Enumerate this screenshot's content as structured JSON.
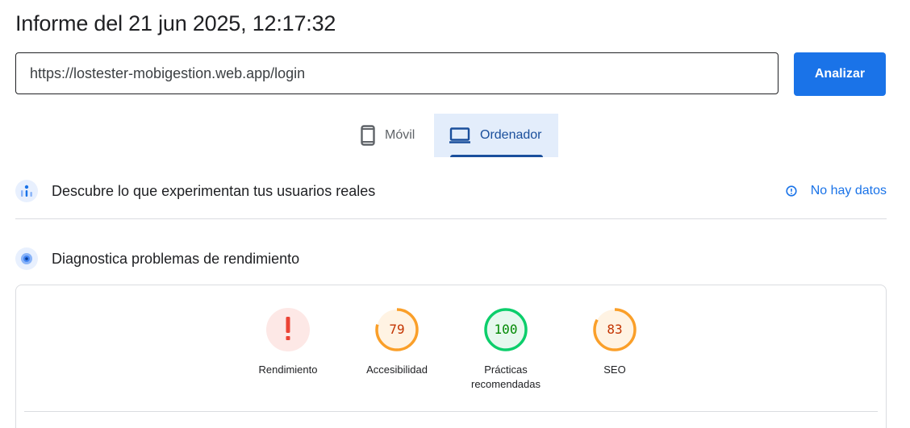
{
  "header": {
    "title": "Informe del 21 jun 2025, 12:17:32"
  },
  "search": {
    "url_value": "https://lostester-mobigestion.web.app/login",
    "analyze_label": "Analizar"
  },
  "device_tabs": [
    {
      "label": "Móvil",
      "icon": "smartphone-icon",
      "selected": false
    },
    {
      "label": "Ordenador",
      "icon": "laptop-icon",
      "selected": true
    }
  ],
  "field_data": {
    "title": "Descubre lo que experimentan tus usuarios reales",
    "icon": "users-chart-icon",
    "status_label": "No hay datos",
    "status_icon": "info-icon"
  },
  "lab_data": {
    "title": "Diagnostica problemas de rendimiento",
    "icon": "diagnostic-target-icon"
  },
  "scores": [
    {
      "label": "Rendimiento",
      "value": "!",
      "status": "error",
      "color": "#eb4335",
      "bg": "#fde8e6"
    },
    {
      "label": "Accesibilidad",
      "value": "79",
      "score": 79,
      "status": "average",
      "color": "#fa9f29",
      "text_color": "#c33300",
      "bg": "#fff3e3"
    },
    {
      "label": "Prácticas recomendadas",
      "value": "100",
      "score": 100,
      "status": "pass",
      "color": "#0cce6b",
      "text_color": "#008800",
      "bg": "#e6f8ee"
    },
    {
      "label": "SEO",
      "value": "83",
      "score": 83,
      "status": "average",
      "color": "#fa9f29",
      "text_color": "#c33300",
      "bg": "#fff3e3"
    }
  ],
  "colors": {
    "accent": "#1a73e8",
    "selected_tab_bg": "#e3edfb",
    "selected_tab_text": "#1a4f9c"
  }
}
